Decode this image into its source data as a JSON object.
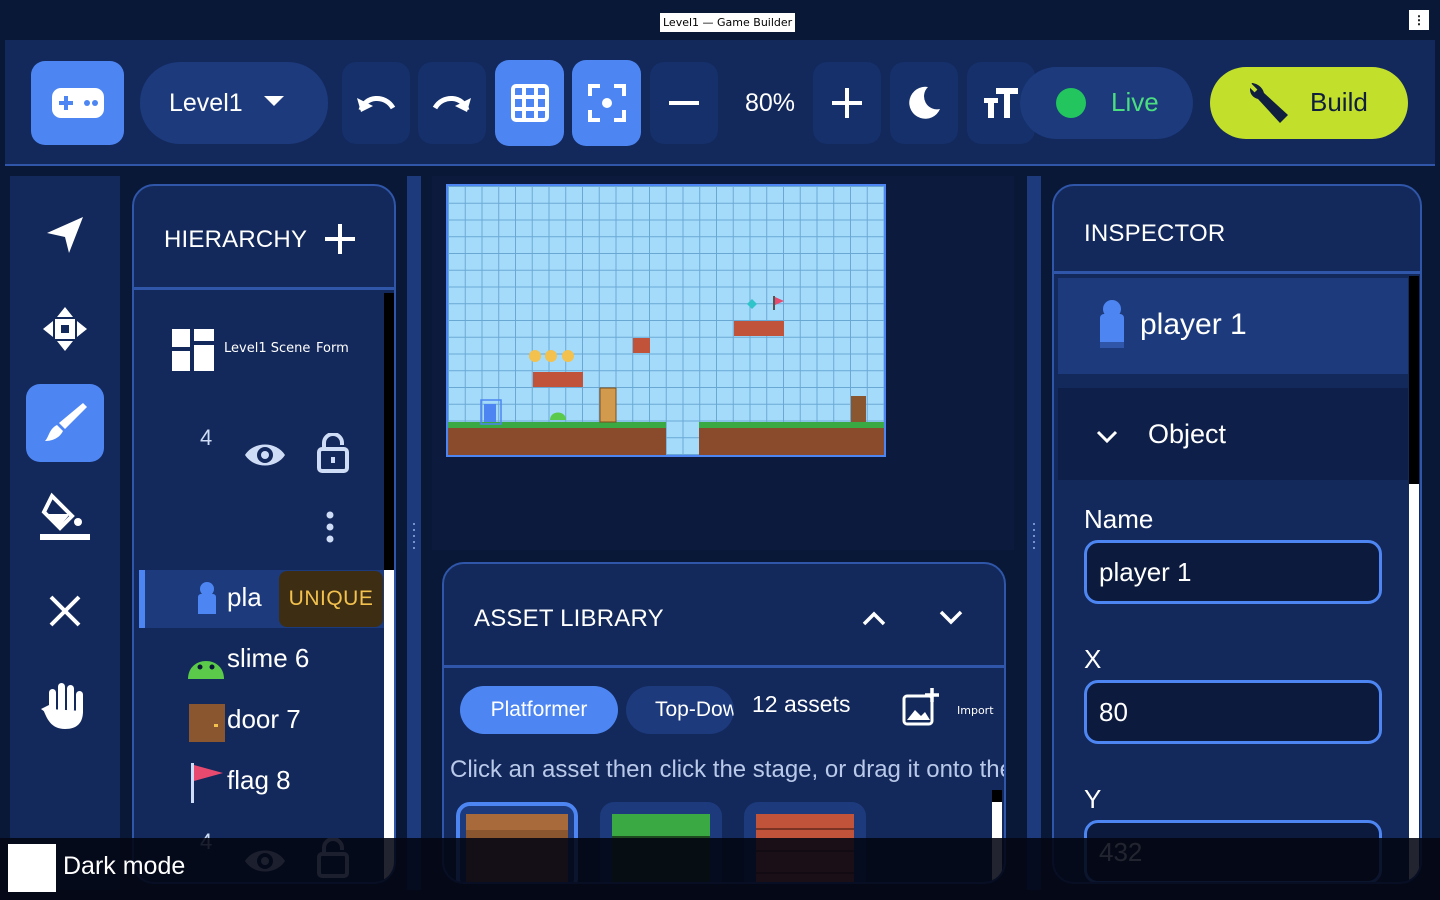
{
  "window": {
    "title": "Level1 — Game Builder",
    "menu_glyph": "⋮"
  },
  "toolbar": {
    "level_name": "Level1",
    "zoom": "80%",
    "live_label": "Live",
    "build_label": "Build",
    "live_color": "#22c55e",
    "build_color": "#c2df2c",
    "accent_color": "#4d86f2"
  },
  "tools": [
    "select-arrow-icon",
    "move-icon",
    "paint-brush-icon",
    "fill-bucket-icon",
    "delete-x-icon",
    "pan-hand-icon"
  ],
  "hierarchy": {
    "title": "HIERARCHY",
    "scene_label": "Level1 Scene",
    "scene_sub": "Form",
    "layer_count": "4",
    "items": [
      {
        "name": "pla",
        "badge": "UNIQUE",
        "icon": "player-icon"
      },
      {
        "name": "slime 6",
        "icon": "slime-icon"
      },
      {
        "name": "door 7",
        "icon": "door-icon"
      },
      {
        "name": "flag 8",
        "icon": "flag-icon"
      }
    ],
    "layer_count_2": "4"
  },
  "assets": {
    "title": "ASSET LIBRARY",
    "tab_active": "Platformer",
    "tab_inactive": "Top-Down",
    "count": "12 assets",
    "import_label": "Import",
    "hint": "Click an asset then click the stage, or drag it onto the stage"
  },
  "inspector": {
    "title": "INSPECTOR",
    "object_name": "player 1",
    "section": "Object",
    "name_label": "Name",
    "name_value": "player 1",
    "x_label": "X",
    "x_value": "80",
    "y_label": "Y",
    "y_value": "432"
  },
  "toast": {
    "text": "Dark mode"
  }
}
